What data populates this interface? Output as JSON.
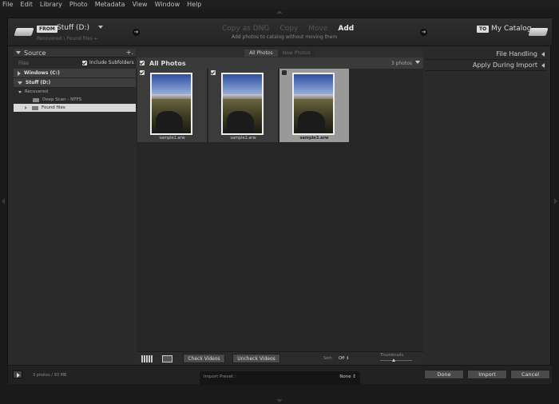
{
  "menu": [
    "File",
    "Edit",
    "Library",
    "Photo",
    "Metadata",
    "View",
    "Window",
    "Help"
  ],
  "topbar": {
    "from_badge": "FROM",
    "from_source": "Stuff (D:)",
    "from_path": "Recovered \\ Found files ←",
    "modes": [
      "Copy as DNG",
      "Copy",
      "Move",
      "Add"
    ],
    "active_mode": "Add",
    "mode_description": "Add photos to catalog without moving them",
    "to_badge": "TO",
    "to_dest": "My Catalog"
  },
  "source": {
    "title": "Source",
    "add_glyph": "+.",
    "files_label": "Files",
    "include_subfolders": "Include Subfolders",
    "volumes": [
      {
        "label": "Windows (C:)",
        "expanded": false
      },
      {
        "label": "Stuff (D:)",
        "expanded": true
      }
    ],
    "tree": [
      {
        "label": "Recovered",
        "indent": 1
      },
      {
        "label": "Deep Scan - NTFS",
        "indent": 2
      },
      {
        "label": "Found files",
        "indent": 2,
        "selected": true
      }
    ]
  },
  "center": {
    "tabs": [
      "All Photos",
      "New Photos"
    ],
    "active_tab": "All Photos",
    "grid_title": "All Photos",
    "photo_count": "3 photos",
    "photos": [
      {
        "name": "sample1.arw",
        "checked": true,
        "selected": false
      },
      {
        "name": "sample2.arw",
        "checked": true,
        "selected": false
      },
      {
        "name": "sample3.arw",
        "checked": true,
        "selected": true
      }
    ],
    "check_videos": "Check Videos",
    "uncheck_videos": "Uncheck Videos",
    "sort_label": "Sort:",
    "sort_value": "Off ↕",
    "thumbnails_label": "Thumbnails"
  },
  "right": {
    "sections": [
      "File Handling",
      "Apply During Import"
    ]
  },
  "footer": {
    "info": "3 photos / 93 MB",
    "preset_label": "Import Preset :",
    "preset_value": "None ↕",
    "done": "Done",
    "import": "Import",
    "cancel": "Cancel"
  }
}
